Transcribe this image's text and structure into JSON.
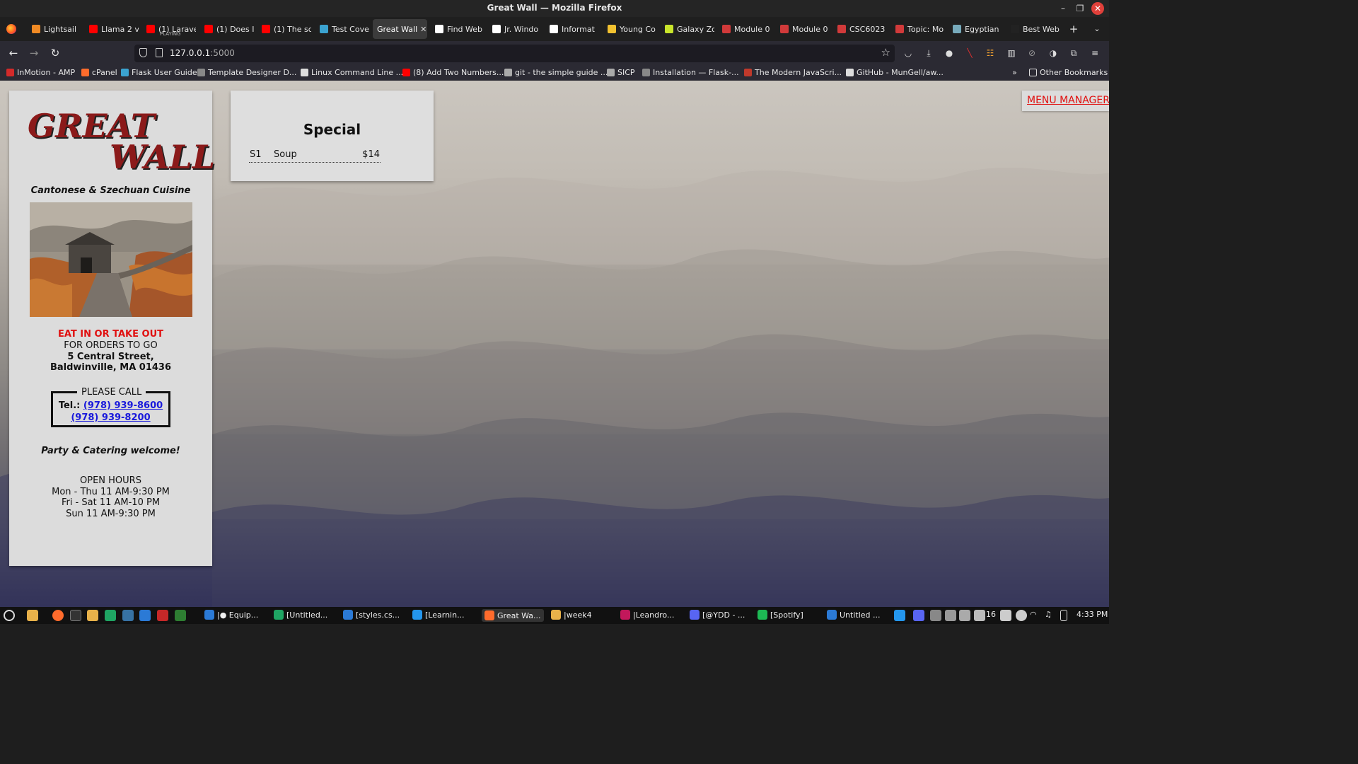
{
  "window": {
    "title": "Great Wall — Mozilla Firefox"
  },
  "tabs": [
    {
      "label": "Lightsail",
      "color": "#f08a24"
    },
    {
      "label": "Llama 2 v",
      "color": "#ff0000"
    },
    {
      "label": "(1) Larave",
      "sub": "PLAYING",
      "color": "#ff0000"
    },
    {
      "label": "(1) Does I",
      "color": "#ff0000"
    },
    {
      "label": "(1) The sc",
      "color": "#ff0000"
    },
    {
      "label": "Test Cove",
      "color": "#3ba3d0"
    },
    {
      "label": "Great Wall",
      "color": "#3b3b3b",
      "active": true
    },
    {
      "label": "Find Web",
      "color": "#ffffff"
    },
    {
      "label": "Jr. Windo",
      "color": "#ffffff"
    },
    {
      "label": "Informat",
      "color": "#ffffff"
    },
    {
      "label": "Young Co",
      "color": "#f2c230"
    },
    {
      "label": "Galaxy Zo",
      "color": "#c9e52b"
    },
    {
      "label": "Module 0",
      "color": "#d13a3a"
    },
    {
      "label": "Module 0",
      "color": "#d13a3a"
    },
    {
      "label": "CSC6023",
      "color": "#d13a3a"
    },
    {
      "label": "Topic: Mo",
      "color": "#d13a3a"
    },
    {
      "label": "Egyptian",
      "color": "#7ab"
    },
    {
      "label": "Best Web",
      "color": "#222"
    }
  ],
  "nav": {
    "url_host": "127.0.0.1",
    "url_port": ":5000"
  },
  "bookmarks": [
    {
      "label": "InMotion - AMP",
      "color": "#d42a2a"
    },
    {
      "label": "cPanel",
      "color": "#ff6c2c"
    },
    {
      "label": "Flask User Guide",
      "color": "#3ba3d0"
    },
    {
      "label": "Template Designer D...",
      "color": "#888888"
    },
    {
      "label": "Linux Command Line ...",
      "color": "#dddddd"
    },
    {
      "label": "(8) Add Two Numbers...",
      "color": "#ff0000"
    },
    {
      "label": "git - the simple guide ...",
      "color": "#aaaaaa"
    },
    {
      "label": "SICP",
      "color": "#aaaaaa"
    },
    {
      "label": "Installation — Flask-...",
      "color": "#888888"
    },
    {
      "label": "The Modern JavaScri...",
      "color": "#c0392b"
    },
    {
      "label": "GitHub - MunGell/aw...",
      "color": "#dddddd"
    }
  ],
  "other_bookmarks": "Other Bookmarks",
  "restaurant": {
    "logo_line1": "GREAT",
    "logo_line2": "WALL",
    "cuisine": "Cantonese & Szechuan Cuisine",
    "eat_in": "EAT IN OR TAKE OUT",
    "orders": "FOR ORDERS TO GO",
    "address1": "5 Central Street,",
    "address2": "Baldwinville, MA 01436",
    "please_call": "PLEASE CALL",
    "tel_label": "Tel.:",
    "phone1": "(978) 939-8600",
    "phone2": "(978) 939-8200",
    "party": "Party & Catering welcome!",
    "hours_title": "OPEN HOURS",
    "hours": [
      "Mon - Thu 11 AM-9:30 PM",
      "Fri - Sat 11 AM-10 PM",
      "Sun 11 AM-9:30 PM"
    ]
  },
  "special": {
    "heading": "Special",
    "items": [
      {
        "code": "S1",
        "name": "Soup",
        "price": "$14"
      }
    ]
  },
  "menu_manager": "MENU MANAGER",
  "taskbar": {
    "windows": [
      {
        "label": "|● Equip...",
        "color": "#2b7ad6"
      },
      {
        "label": "[Untitled...",
        "color": "#1fa463"
      },
      {
        "label": "[styles.cs...",
        "color": "#2b7ad6"
      },
      {
        "label": "[Learnin...",
        "color": "#2496ed"
      },
      {
        "label": "Great Wa...",
        "color": "#ff6b2c",
        "active": true
      },
      {
        "label": "|week4",
        "color": "#e8b14a"
      },
      {
        "label": "|Leandro...",
        "color": "#c2185b"
      },
      {
        "label": "[@YDD - ...",
        "color": "#5865f2"
      },
      {
        "label": "[Spotify]",
        "color": "#1db954"
      },
      {
        "label": "Untitled ...",
        "color": "#2b7ad6"
      }
    ],
    "tray_count": "16",
    "clock": "4:33 PM"
  }
}
